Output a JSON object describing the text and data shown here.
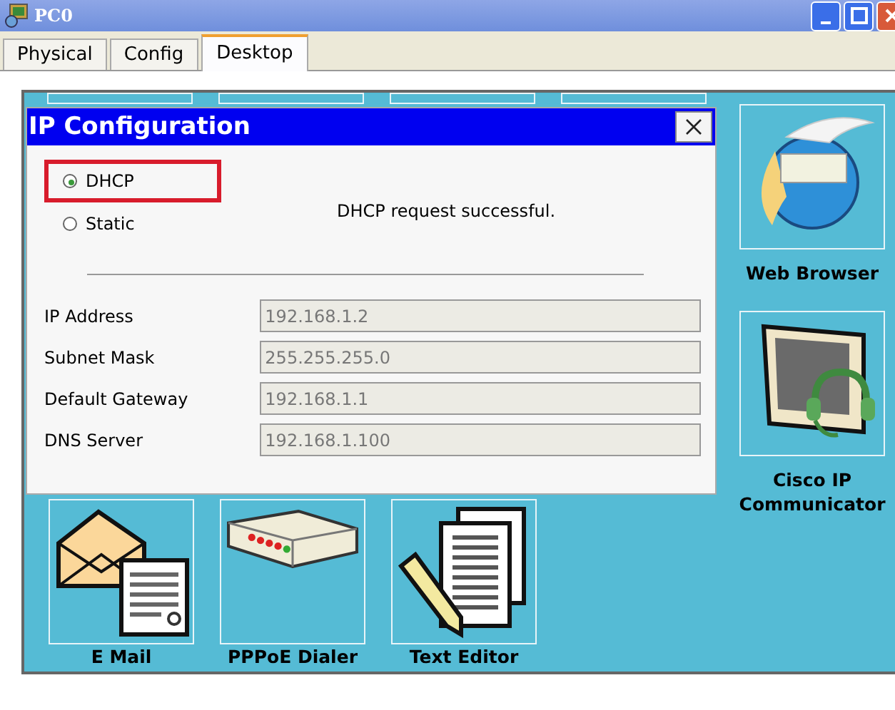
{
  "window": {
    "title": "PC0"
  },
  "tabs": [
    {
      "label": "Physical",
      "selected": false
    },
    {
      "label": "Config",
      "selected": false
    },
    {
      "label": "Desktop",
      "selected": true
    }
  ],
  "dialog": {
    "title": "IP Configuration",
    "modes": [
      {
        "label": "DHCP",
        "selected": true,
        "highlighted": true
      },
      {
        "label": "Static",
        "selected": false,
        "highlighted": false
      }
    ],
    "status": "DHCP request successful.",
    "fields": [
      {
        "label": "IP Address",
        "value": "192.168.1.2"
      },
      {
        "label": "Subnet Mask",
        "value": "255.255.255.0"
      },
      {
        "label": "Default Gateway",
        "value": "192.168.1.1"
      },
      {
        "label": "DNS Server",
        "value": "192.168.1.100"
      }
    ]
  },
  "side_apps": [
    {
      "label": "Web Browser",
      "kind": "browser"
    },
    {
      "label": "Cisco IP Communicator",
      "kind": "phone"
    }
  ],
  "bottom_apps": [
    {
      "label": "E Mail",
      "kind": "email"
    },
    {
      "label": "PPPoE Dialer",
      "kind": "dialer"
    },
    {
      "label": "Text Editor",
      "kind": "editor"
    }
  ]
}
